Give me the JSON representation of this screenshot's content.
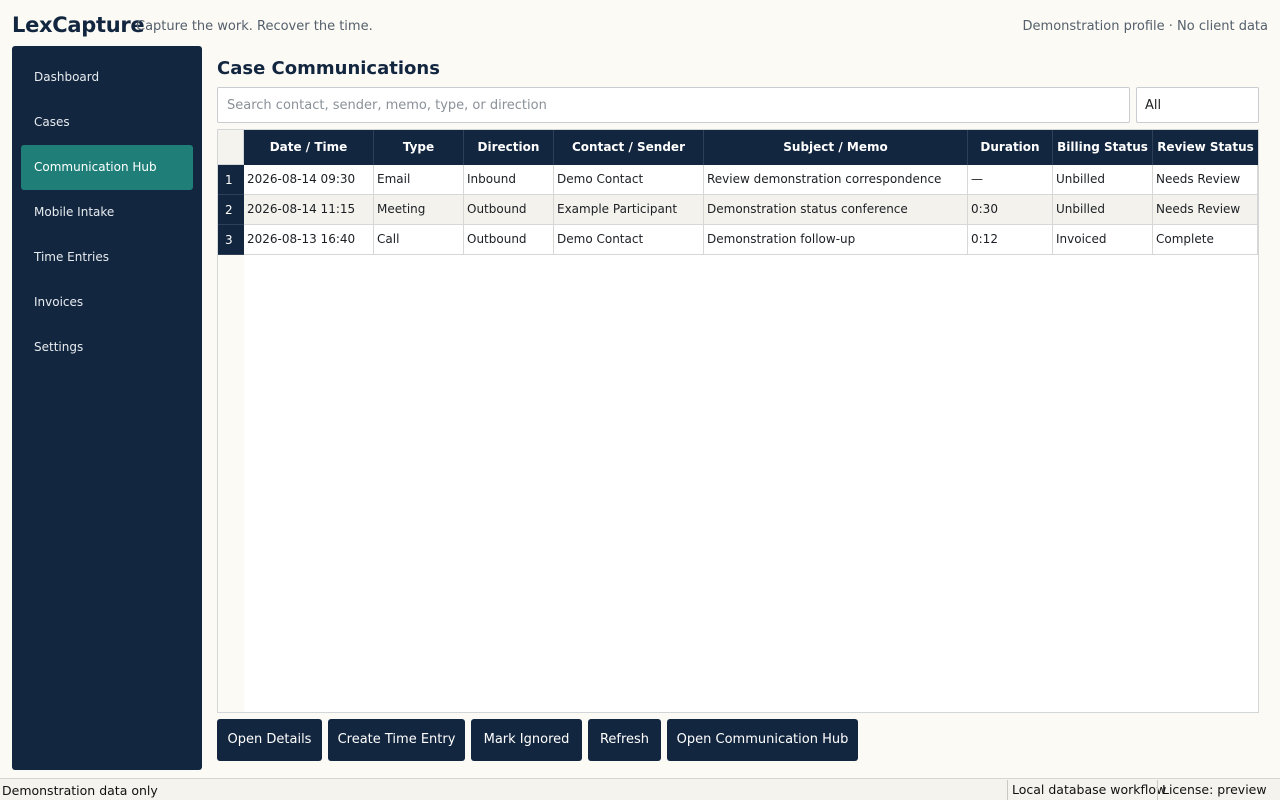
{
  "app": {
    "name": "LexCapture",
    "tagline": "Capture the work. Recover the time.",
    "profile": "Demonstration profile · No client data"
  },
  "sidebar": {
    "items": [
      {
        "label": "Dashboard",
        "active": false
      },
      {
        "label": "Cases",
        "active": false
      },
      {
        "label": "Communication Hub",
        "active": true
      },
      {
        "label": "Mobile Intake",
        "active": false
      },
      {
        "label": "Time Entries",
        "active": false
      },
      {
        "label": "Invoices",
        "active": false
      },
      {
        "label": "Settings",
        "active": false
      }
    ]
  },
  "main": {
    "title": "Case Communications",
    "search": {
      "placeholder": "Search contact, sender, memo, type, or direction",
      "value": ""
    },
    "filter": {
      "selected": "All"
    }
  },
  "table": {
    "columns": [
      "Date / Time",
      "Type",
      "Direction",
      "Contact / Sender",
      "Subject / Memo",
      "Duration",
      "Billing Status",
      "Review Status"
    ],
    "rows": [
      {
        "num": "1",
        "cells": [
          "2026-08-14 09:30",
          "Email",
          "Inbound",
          "Demo Contact",
          "Review demonstration correspondence",
          "—",
          "Unbilled",
          "Needs Review"
        ]
      },
      {
        "num": "2",
        "cells": [
          "2026-08-14 11:15",
          "Meeting",
          "Outbound",
          "Example Participant",
          "Demonstration status conference",
          "0:30",
          "Unbilled",
          "Needs Review"
        ]
      },
      {
        "num": "3",
        "cells": [
          "2026-08-13 16:40",
          "Call",
          "Outbound",
          "Demo Contact",
          "Demonstration follow-up",
          "0:12",
          "Invoiced",
          "Complete"
        ]
      }
    ]
  },
  "actions": {
    "open_details": "Open Details",
    "create_time_entry": "Create Time Entry",
    "mark_ignored": "Mark Ignored",
    "refresh": "Refresh",
    "open_hub": "Open Communication Hub"
  },
  "status": {
    "left": "Demonstration data only",
    "workflow": "Local database workflow",
    "license": "License: preview"
  },
  "colors": {
    "navy": "#13263f",
    "accent": "#1f7f78",
    "background": "#fbfaf5"
  }
}
